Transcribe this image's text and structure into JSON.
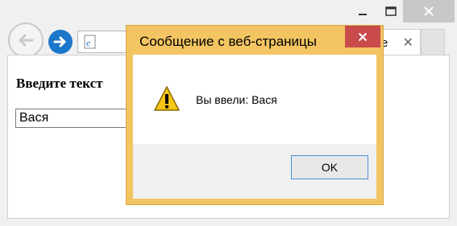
{
  "window": {
    "controls": {
      "minimize": "minimize",
      "maximize": "maximize",
      "close": "close"
    }
  },
  "nav": {
    "back": "back",
    "forward": "forward",
    "tab_partial_text": "е"
  },
  "page": {
    "heading": "Введите текст",
    "input_value": "Вася"
  },
  "dialog": {
    "title": "Сообщение с веб-страницы",
    "message": "Вы ввели: Вася",
    "ok_label": "OK",
    "tab_close_glyph": "✕"
  },
  "colors": {
    "dialog_frame": "#f3c562",
    "close_red": "#c94b4b",
    "forward_blue": "#1a77c9"
  }
}
